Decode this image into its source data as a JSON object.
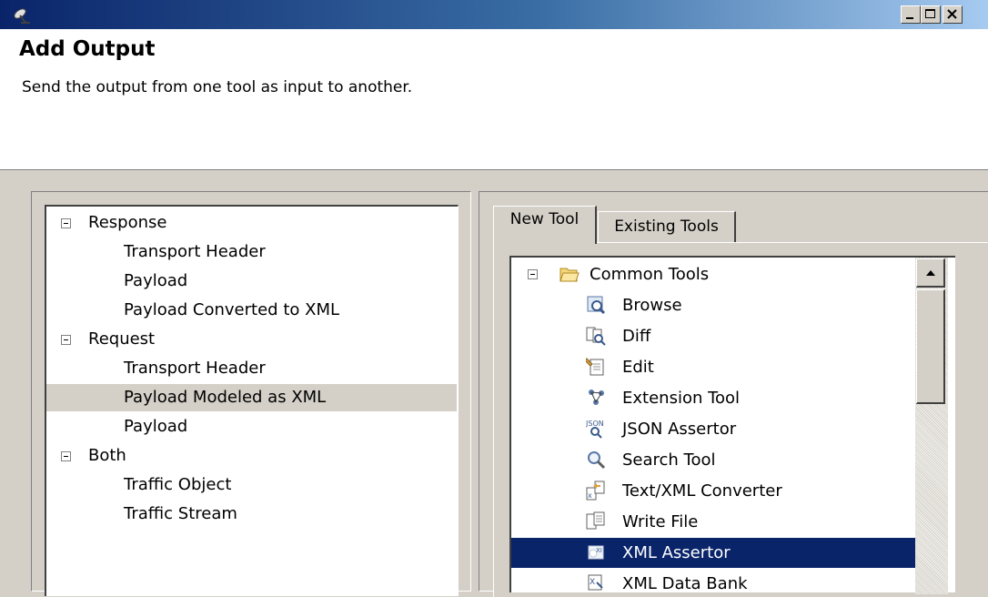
{
  "window": {
    "title": "",
    "controls": [
      "minimize",
      "maximize",
      "close"
    ]
  },
  "header": {
    "title": "Add Output",
    "description": "Send the output from one tool as input to another."
  },
  "output_tree": {
    "groups": [
      {
        "label": "Response",
        "items": [
          "Transport Header",
          "Payload",
          "Payload Converted to XML"
        ]
      },
      {
        "label": "Request",
        "items": [
          "Transport Header",
          "Payload Modeled as XML",
          "Payload"
        ]
      },
      {
        "label": "Both",
        "items": [
          "Traffic Object",
          "Traffic Stream"
        ]
      }
    ],
    "selected": "Payload Modeled as XML"
  },
  "tabs": [
    {
      "label": "New Tool",
      "active": true
    },
    {
      "label": "Existing Tools",
      "active": false
    }
  ],
  "tools": {
    "category": "Common Tools",
    "items": [
      {
        "label": "Browse",
        "icon": "browse-icon"
      },
      {
        "label": "Diff",
        "icon": "diff-icon"
      },
      {
        "label": "Edit",
        "icon": "edit-icon"
      },
      {
        "label": "Extension Tool",
        "icon": "extension-tool-icon"
      },
      {
        "label": "JSON Assertor",
        "icon": "json-assertor-icon"
      },
      {
        "label": "Search Tool",
        "icon": "search-icon"
      },
      {
        "label": "Text/XML Converter",
        "icon": "text-xml-converter-icon"
      },
      {
        "label": "Write File",
        "icon": "write-file-icon"
      },
      {
        "label": "XML Assertor",
        "icon": "xml-assertor-icon"
      },
      {
        "label": "XML Data Bank",
        "icon": "xml-data-bank-icon"
      }
    ],
    "selected": "XML Assertor"
  },
  "colors": {
    "selection": "#0a246a",
    "title_bar_start": "#0a246a",
    "title_bar_end": "#a6caf0",
    "face": "#d4d0c8"
  }
}
